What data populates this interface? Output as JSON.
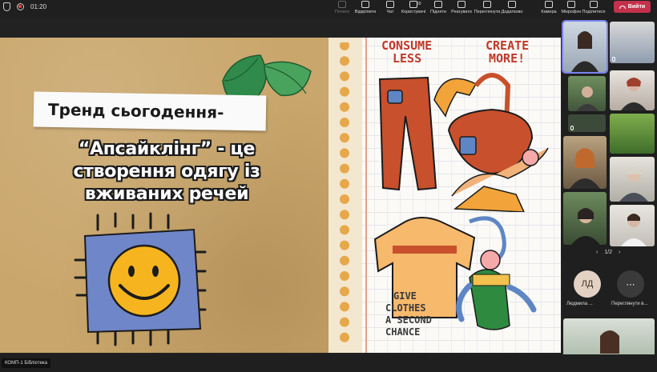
{
  "topbar": {
    "timer": "01:20",
    "buttons": [
      {
        "label": "Почати",
        "icon": "play-icon",
        "dim": true
      },
      {
        "label": "Відкріпити",
        "icon": "unpin-icon",
        "dim": false
      },
      {
        "label": "Чат",
        "icon": "chat-icon",
        "dim": false
      },
      {
        "label": "Користувачі",
        "icon": "people-icon",
        "dim": false,
        "badge": "60"
      },
      {
        "label": "Підняти",
        "icon": "raise-hand-icon",
        "dim": false
      },
      {
        "label": "Реагувати",
        "icon": "react-icon",
        "dim": false
      },
      {
        "label": "Переглянути",
        "icon": "view-icon",
        "dim": false
      },
      {
        "label": "Додатково",
        "icon": "more-icon",
        "dim": false
      },
      {
        "label": "Камера",
        "icon": "camera-icon",
        "dim": false
      },
      {
        "label": "Мікрофон",
        "icon": "microphone-icon",
        "dim": false
      },
      {
        "label": "Поділитися",
        "icon": "share-icon",
        "dim": false
      }
    ],
    "leave_label": "Вийти"
  },
  "slide": {
    "title_line1": "Тренд сьогодення-",
    "title_line2a": "“Апсайклінг” - це",
    "title_line2b": "створення одягу із",
    "title_line2c": "вживаних речей",
    "consume": [
      "CONSUME",
      "LESS"
    ],
    "create": [
      "CREATE",
      "MORE!"
    ],
    "give": [
      "GIVE",
      "CLOTHES",
      "A SECOND",
      "CHANCE"
    ]
  },
  "presenter_name": "КОМП-1 Бібліотека",
  "pager": "1/2",
  "participants": {
    "avatar_initials": "ЛД",
    "avatar_name": "Людмила ...",
    "more_label": "Переглянути в..."
  },
  "colors": {
    "accent": "#7b83eb",
    "leave": "#c4314b",
    "kraft": "#c9a66b"
  }
}
